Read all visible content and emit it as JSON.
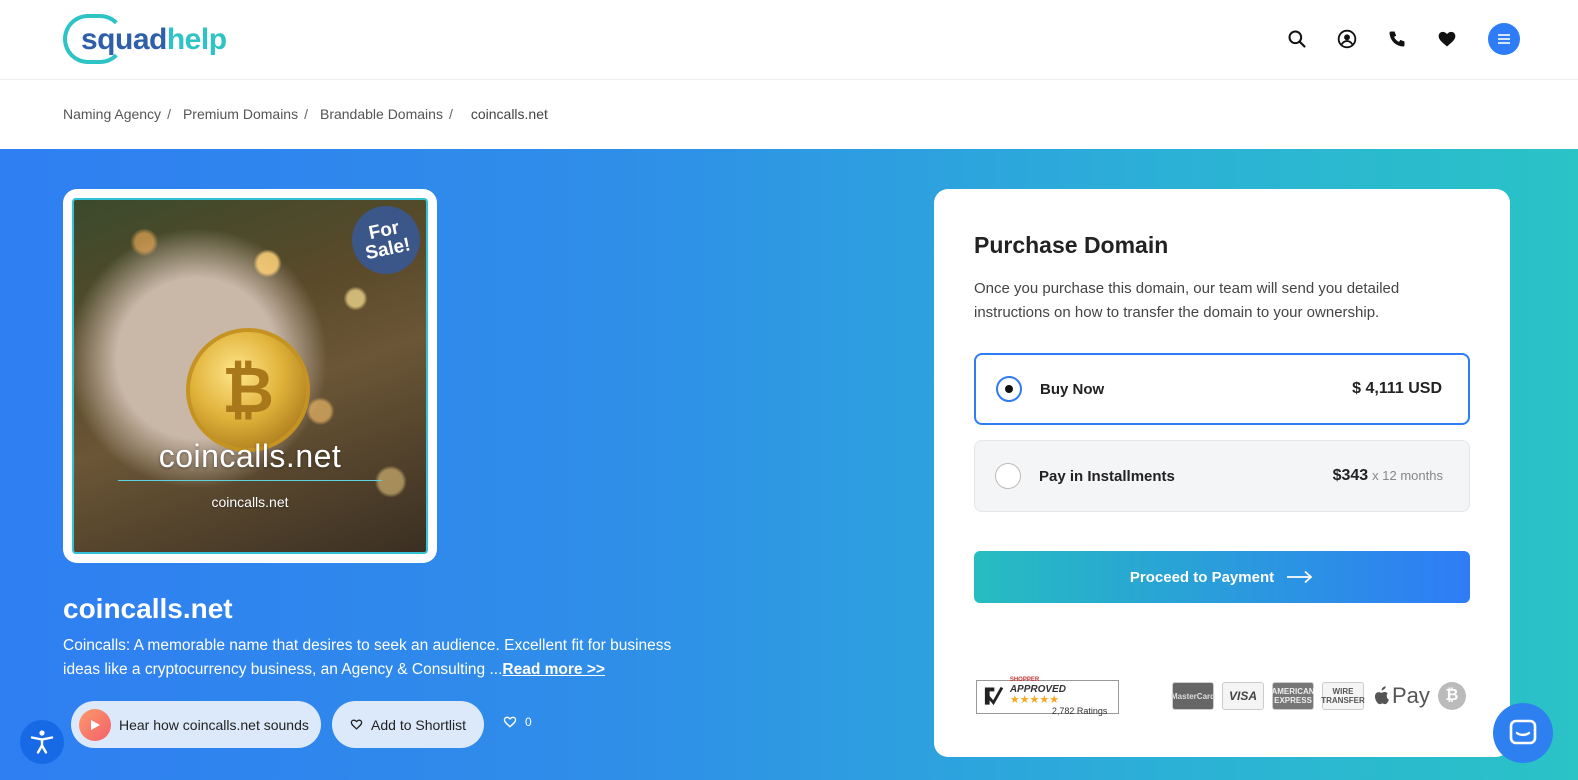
{
  "header": {
    "logo_squad": "squad",
    "logo_help": "help",
    "icons": [
      "search-icon",
      "user-icon",
      "phone-icon",
      "heart-icon",
      "menu-icon"
    ]
  },
  "breadcrumb": {
    "items": [
      "Naming Agency",
      "Premium Domains",
      "Brandable Domains"
    ],
    "current": "coincalls.net",
    "separator": "/"
  },
  "image": {
    "for_sale_line1": "For",
    "for_sale_line2": "Sale!",
    "domain_big": "coincalls.net",
    "domain_small": "coincalls.net",
    "coin_symbol": "₿"
  },
  "domain": {
    "name": "coincalls.net",
    "description": "Coincalls: A memorable name that desires to seek an audience. Excellent fit for business ideas like a cryptocurrency business, an Agency & Consulting ...",
    "read_more": "Read more >>"
  },
  "actions": {
    "hear_label": "Hear how coincalls.net sounds",
    "shortlist_label": "Add to Shortlist",
    "likes_count": "0"
  },
  "purchase": {
    "title": "Purchase Domain",
    "description": "Once you purchase this domain, our team will send you detailed instructions on how to transfer the domain to your ownership.",
    "options": [
      {
        "label": "Buy Now",
        "price": "$ 4,111 USD",
        "sub": "",
        "selected": true
      },
      {
        "label": "Pay in Installments",
        "price": "$343",
        "sub": "x 12 months",
        "selected": false
      }
    ],
    "proceed_label": "Proceed to Payment"
  },
  "trust": {
    "shopper_brand": "SHOPPER",
    "shopper_approved": "APPROVED",
    "stars": "★★★★★",
    "ratings": "2,782 Ratings"
  },
  "payments": {
    "mastercard": "MasterCard",
    "visa": "VISA",
    "amex": "AMERICAN EXPRESS",
    "wire": "WIRE TRANSFER",
    "apple_pay": "Pay",
    "bitcoin": "₿"
  },
  "colors": {
    "accent": "#2e7cf6",
    "teal": "#2ec4c6",
    "hero_start": "#2f7ef2",
    "hero_end": "#2ac3c6"
  }
}
